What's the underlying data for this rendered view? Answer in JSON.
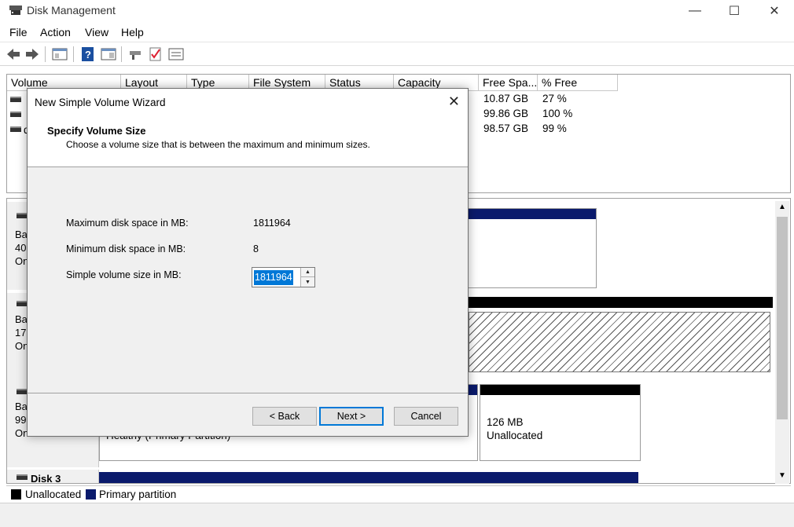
{
  "window": {
    "title": "Disk Management",
    "min_glyph": "—",
    "max_glyph": "☐",
    "close_glyph": "✕"
  },
  "menu": [
    "File",
    "Action",
    "View",
    "Help"
  ],
  "volume_table": {
    "columns": [
      "Volume",
      "Layout",
      "Type",
      "File System",
      "Status",
      "Capacity",
      "Free Spa...",
      "% Free"
    ],
    "rows": [
      {
        "volume": "",
        "free_space": "10.87 GB",
        "pct_free": "27 %"
      },
      {
        "volume": "",
        "free_space": "99.86 GB",
        "pct_free": "100 %"
      },
      {
        "volume": "d",
        "free_space": "98.57 GB",
        "pct_free": "99 %"
      }
    ]
  },
  "disks": [
    {
      "lines": [
        "Ba",
        "40.",
        "On"
      ]
    },
    {
      "lines": [
        "Ba",
        "17(",
        "On"
      ]
    },
    {
      "lines": [
        "Ba",
        "99.",
        "Online"
      ]
    },
    {
      "lines": [
        "Disk 3"
      ]
    }
  ],
  "partitions": {
    "disk2_primary_status": "Healthy (Primary Partition)",
    "disk2_unalloc_size": "126 MB",
    "disk2_unalloc_label": "Unallocated"
  },
  "legend": {
    "unallocated": "Unallocated",
    "primary": "Primary partition",
    "unallocated_color": "#000000",
    "primary_color": "#0a1a6c"
  },
  "dialog": {
    "title": "New Simple Volume Wizard",
    "heading": "Specify Volume Size",
    "subheading": "Choose a volume size that is between the maximum and minimum sizes.",
    "max_label": "Maximum disk space in MB:",
    "max_value": "1811964",
    "min_label": "Minimum disk space in MB:",
    "min_value": "8",
    "size_label": "Simple volume size in MB:",
    "size_value": "1811964",
    "back_label": "< Back",
    "next_label": "Next >",
    "cancel_label": "Cancel",
    "close_glyph": "✕"
  }
}
